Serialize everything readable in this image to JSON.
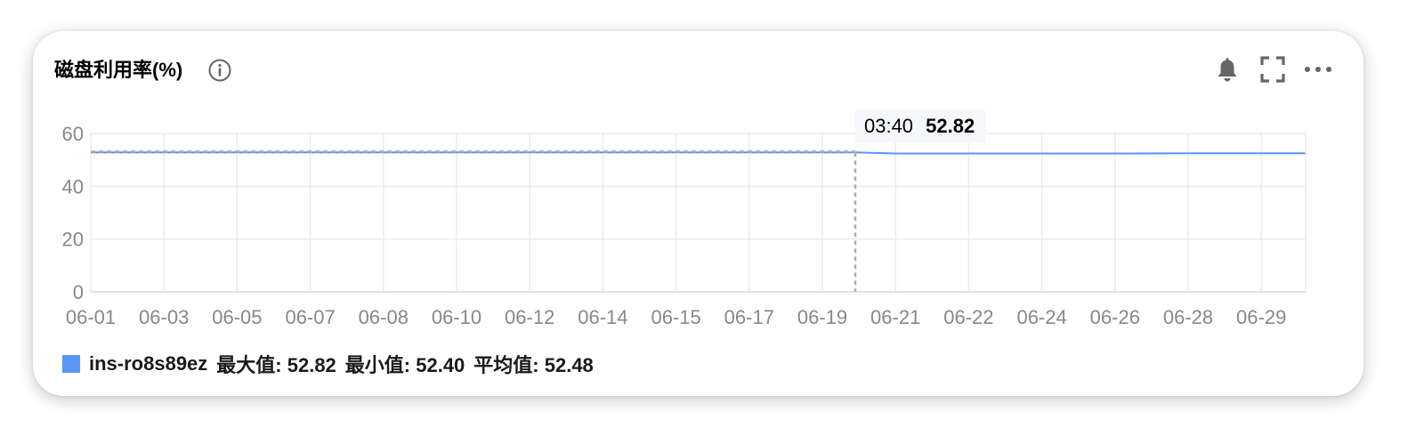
{
  "panel": {
    "title": "磁盘利用率(%)",
    "icons": {
      "info": "info-icon",
      "alarm": "bell-icon",
      "fullscreen": "fullscreen-icon",
      "more": "more-icon"
    }
  },
  "tooltip": {
    "time": "03:40",
    "value": "52.82"
  },
  "legend": {
    "name": "ins-ro8s89ez",
    "max_label": "最大值: 52.82",
    "min_label": "最小值: 52.40",
    "avg_label": "平均值: 52.48"
  },
  "colors": {
    "series": "#5b95f5",
    "grid": "#ebebeb",
    "tick_text": "#888888",
    "icon": "#666666"
  },
  "chart_data": {
    "type": "line",
    "title": "磁盘利用率(%)",
    "xlabel": "",
    "ylabel": "",
    "ylim": [
      0,
      60
    ],
    "yticks": [
      0,
      20,
      40,
      60
    ],
    "xticks": [
      "06-01",
      "06-03",
      "06-05",
      "06-07",
      "06-08",
      "06-10",
      "06-12",
      "06-14",
      "06-15",
      "06-17",
      "06-19",
      "06-21",
      "06-22",
      "06-24",
      "06-26",
      "06-28",
      "06-29"
    ],
    "grid": true,
    "legend_position": "bottom-left",
    "series": [
      {
        "name": "ins-ro8s89ez",
        "color": "#5b95f5",
        "x": [
          0,
          1,
          2,
          3,
          4,
          5,
          6,
          7,
          8,
          9,
          10,
          10.45,
          11,
          12,
          13,
          14,
          15,
          15.5,
          16,
          16.6
        ],
        "values": [
          52.82,
          52.82,
          52.82,
          52.82,
          52.82,
          52.82,
          52.82,
          52.82,
          52.82,
          52.82,
          52.82,
          52.82,
          52.42,
          52.42,
          52.42,
          52.42,
          52.5,
          52.48,
          52.5,
          52.5
        ]
      }
    ],
    "tooltip": {
      "x": 10.45,
      "label": "03:40",
      "value": 52.82
    }
  }
}
